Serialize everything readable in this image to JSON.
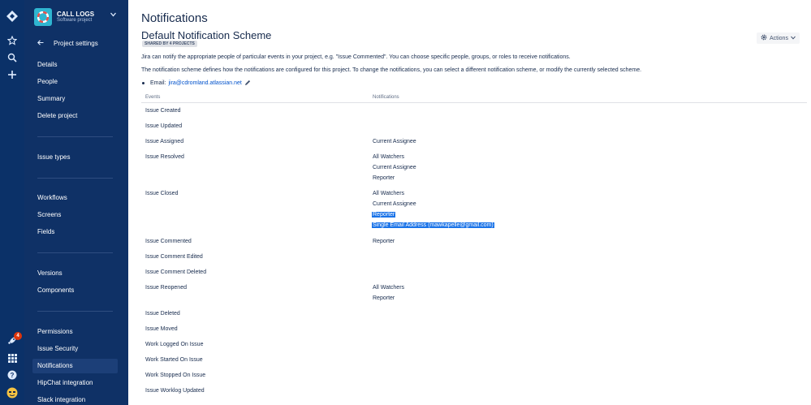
{
  "project": {
    "name": "CALL LOGS",
    "type": "Software project"
  },
  "rail": {
    "notifications_count": "4"
  },
  "sidebar": {
    "back_label": "Project settings",
    "items": [
      {
        "label": "Details"
      },
      {
        "label": "People"
      },
      {
        "label": "Summary"
      },
      {
        "label": "Delete project"
      },
      {
        "label": "Issue types"
      },
      {
        "label": "Workflows"
      },
      {
        "label": "Screens"
      },
      {
        "label": "Fields"
      },
      {
        "label": "Versions"
      },
      {
        "label": "Components"
      },
      {
        "label": "Permissions"
      },
      {
        "label": "Issue Security"
      },
      {
        "label": "Notifications"
      },
      {
        "label": "HipChat integration"
      },
      {
        "label": "Slack integration"
      }
    ]
  },
  "main": {
    "page_title": "Notifications",
    "scheme_title": "Default Notification Scheme",
    "shared_badge": "SHARED BY 4 PROJECTS",
    "actions_label": "Actions",
    "description_1": "Jira can notify the appropriate people of particular events in your project, e.g. \"Issue Commented\". You can choose specific people, groups, or roles to receive notifications.",
    "description_2": "The notification scheme defines how the notifications are configured for this project. To change the notifications, you can select a different notification scheme, or modify the currently selected scheme.",
    "email_label": "Email:",
    "email_value": "jira@cdromland.atlassian.net",
    "columns": {
      "events": "Events",
      "notifications": "Notifications"
    },
    "events": [
      {
        "name": "Issue Created",
        "notifications": []
      },
      {
        "name": "Issue Updated",
        "notifications": []
      },
      {
        "name": "Issue Assigned",
        "notifications": [
          "Current Assignee"
        ]
      },
      {
        "name": "Issue Resolved",
        "notifications": [
          "All Watchers",
          "Current Assignee",
          "Reporter"
        ]
      },
      {
        "name": "Issue Closed",
        "notifications": [
          "All Watchers",
          "Current Assignee",
          "Reporter",
          "Single Email Address (mawkapelle@gmail.com)"
        ]
      },
      {
        "name": "Issue Commented",
        "notifications": [
          "Reporter"
        ]
      },
      {
        "name": "Issue Comment Edited",
        "notifications": []
      },
      {
        "name": "Issue Comment Deleted",
        "notifications": []
      },
      {
        "name": "Issue Reopened",
        "notifications": [
          "All Watchers",
          "Reporter"
        ]
      },
      {
        "name": "Issue Deleted",
        "notifications": []
      },
      {
        "name": "Issue Moved",
        "notifications": []
      },
      {
        "name": "Work Logged On Issue",
        "notifications": []
      },
      {
        "name": "Work Started On Issue",
        "notifications": []
      },
      {
        "name": "Work Stopped On Issue",
        "notifications": []
      },
      {
        "name": "Issue Worklog Updated",
        "notifications": []
      }
    ]
  },
  "colors": {
    "rail_bg": "#0b3168",
    "sidebar_bg": "#0f3166",
    "selection_highlight": "#1a73e8",
    "link": "#0052cc"
  }
}
